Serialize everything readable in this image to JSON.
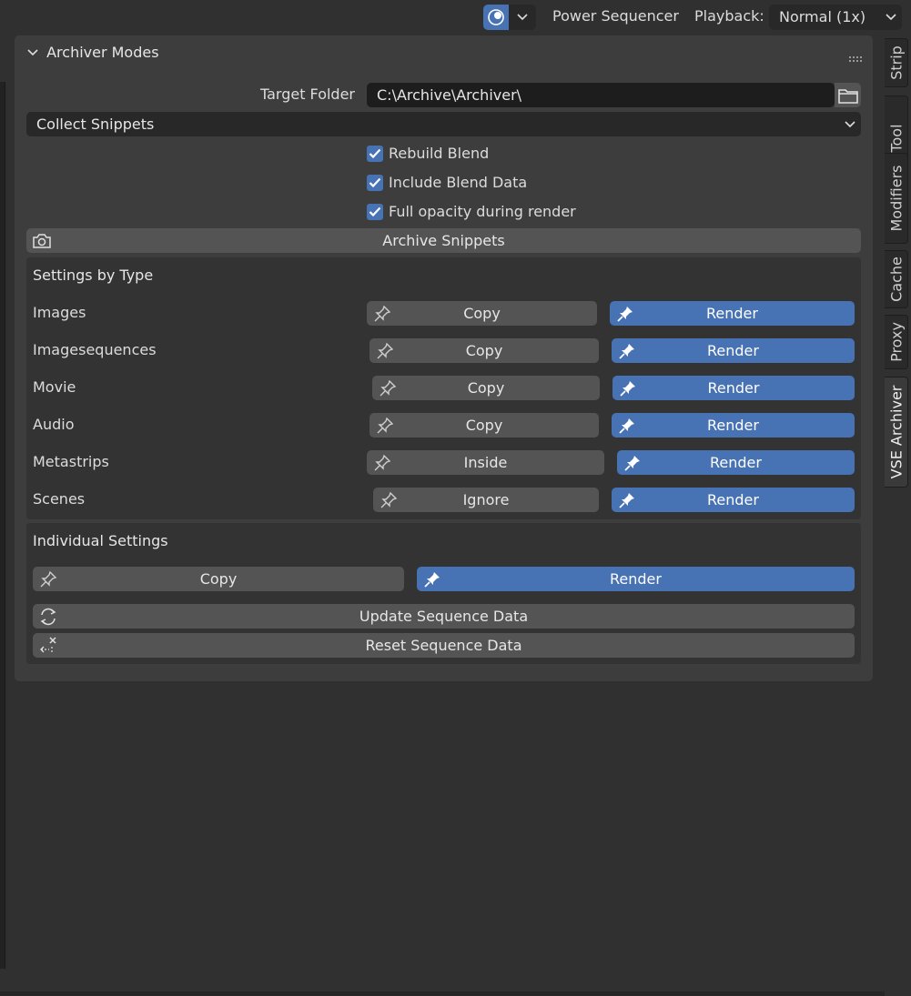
{
  "header": {
    "overlay_icon": "overlay-icon",
    "editor_name": "Power Sequencer",
    "playback_label": "Playback:",
    "playback_value": "Normal (1x)"
  },
  "tabs": [
    "Strip",
    "Tool",
    "Modifiers",
    "Cache",
    "Proxy",
    "VSE Archiver"
  ],
  "active_tab": "VSE Archiver",
  "panel": {
    "title": "Archiver Modes",
    "target_folder_label": "Target Folder",
    "target_folder_value": "C:\\Archive\\Archiver\\",
    "mode_value": "Collect Snippets",
    "checkboxes": [
      {
        "label": "Rebuild Blend",
        "checked": true
      },
      {
        "label": "Include Blend Data",
        "checked": true
      },
      {
        "label": "Full opacity during render",
        "checked": true
      }
    ],
    "archive_button": "Archive Snippets"
  },
  "settings_by_type": {
    "title": "Settings by Type",
    "rows": [
      {
        "label": "Images",
        "option": "Copy",
        "render": "Render"
      },
      {
        "label": "Imagesequences",
        "option": "Copy",
        "render": "Render"
      },
      {
        "label": "Movie",
        "option": "Copy",
        "render": "Render"
      },
      {
        "label": "Audio",
        "option": "Copy",
        "render": "Render"
      },
      {
        "label": "Metastrips",
        "option": "Inside",
        "render": "Render"
      },
      {
        "label": "Scenes",
        "option": "Ignore",
        "render": "Render"
      }
    ]
  },
  "individual_settings": {
    "title": "Individual Settings",
    "copy": "Copy",
    "render": "Render",
    "update": "Update Sequence Data",
    "reset": "Reset Sequence Data"
  },
  "colors": {
    "accent": "#4772b3",
    "background": "#303030",
    "panel": "#3d3d3d",
    "subpanel": "#333333",
    "button": "#545454"
  }
}
